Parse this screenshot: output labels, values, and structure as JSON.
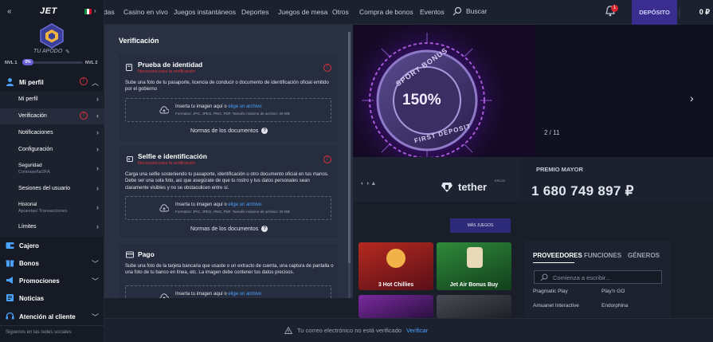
{
  "topnav": {
    "items": [
      "das",
      "Casino en vivo",
      "Juegos instantáneos",
      "Deportes",
      "Juegos de mesa",
      "Otros",
      "Compra de bonos",
      "Eventos"
    ],
    "search_label": "Buscar",
    "notif_count": "1",
    "deposit_label": "DEPÓSITO",
    "balance": "0 ₽"
  },
  "sidebar": {
    "logo": "JET",
    "nickname": "TU APODO",
    "level_from": "NVL 1",
    "level_to": "NVL 2",
    "level_pill": "0%",
    "level_progress": 0.08,
    "profile": {
      "label": "Mi perfil",
      "warn": "!"
    },
    "profile_items": [
      {
        "label": "Mi perfil",
        "sub": ""
      },
      {
        "label": "Verificación",
        "sub": ""
      },
      {
        "label": "Notificaciones",
        "sub": ""
      },
      {
        "label": "Configuración",
        "sub": ""
      },
      {
        "label": "Seguridad",
        "sub": "Contraseña/2FA"
      },
      {
        "label": "Sesiones del usuario",
        "sub": ""
      },
      {
        "label": "Historial",
        "sub": "Apuestas/ Transacciones"
      },
      {
        "label": "Límites",
        "sub": ""
      }
    ],
    "sections": [
      {
        "label": "Cajero"
      },
      {
        "label": "Bonos"
      },
      {
        "label": "Promociones"
      },
      {
        "label": "Noticias"
      },
      {
        "label": "Atención al cliente"
      }
    ],
    "social": "Siguenos en las redes sociales",
    "colors": {
      "accent": "#6a5fd6",
      "warn": "#e0333d"
    }
  },
  "verification": {
    "title": "Verificación",
    "cards": [
      {
        "title": "Prueba de identidad",
        "required": "Necesario para la verificación",
        "desc": "Sube una foto de tu pasaporte, licencia de conducir o documento de identificación oficial emitido por el gobierno",
        "drop_text": "Inserta tu imagen aquí o",
        "drop_link": "elige un archivo",
        "drop_formats": "Formatos: JPG, JPEG, PNG, PDF. Tamaño máximo de archivo: 30 MB",
        "norms": "Normas de los documentos"
      },
      {
        "title": "Selfie e identificación",
        "required": "Necesario para la verificación",
        "desc": "Carga una selfie sosteniendo tu pasaporte, identificación u otro documento oficial en tus manos. Debe ser una sola foto, así que asegúrate de que tu rostro y tus datos personales sean claramente visibles y no se obstaculicen entre sí.",
        "drop_text": "Inserta tu imagen aquí o",
        "drop_link": "elige un archivo",
        "drop_formats": "Formatos: JPG, JPEG, PNG, PDF. Tamaño máximo de archivo: 30 MB",
        "norms": "Normas de los documentos"
      },
      {
        "title": "Pago",
        "required": "",
        "desc": "Sube una foto de la tarjeta bancaria que usaste o un extracto de cuenta, una captura de pantalla o una foto de tu banco en línea, etc. La imagen debe contener tus datos precisos.",
        "drop_text": "Inserta tu imagen aquí o",
        "drop_link": "elige un archivo",
        "drop_formats": "",
        "norms": ""
      }
    ]
  },
  "hero": {
    "badge_top": "SPORT BONUS",
    "badge_value": "150%",
    "badge_bottom": "FIRST DEPOSIT",
    "counter": "2 / 11"
  },
  "promo": {
    "tether_label": "tether",
    "tether_mini": "ERC20",
    "jackpot_label": "PREMIO MAYOR",
    "jackpot_value": "1 680 749 897 ₽",
    "more_games": "MÁS JUEGOS"
  },
  "games": [
    {
      "name": "3 Hot Chillies"
    },
    {
      "name": "Jet Air Bonus Buy"
    }
  ],
  "providers": {
    "tabs": [
      "PROVEEDORES",
      "FUNCIONES",
      "GÉNEROS"
    ],
    "search_placeholder": "Comienza a escribir...",
    "items": [
      "Pragmatic Play",
      "Play'n GO",
      "Amuanet Interactive",
      "Endorphina"
    ]
  },
  "verify_bar": {
    "text": "Tu correo electrónico no está verificado",
    "link": "Verificar"
  }
}
